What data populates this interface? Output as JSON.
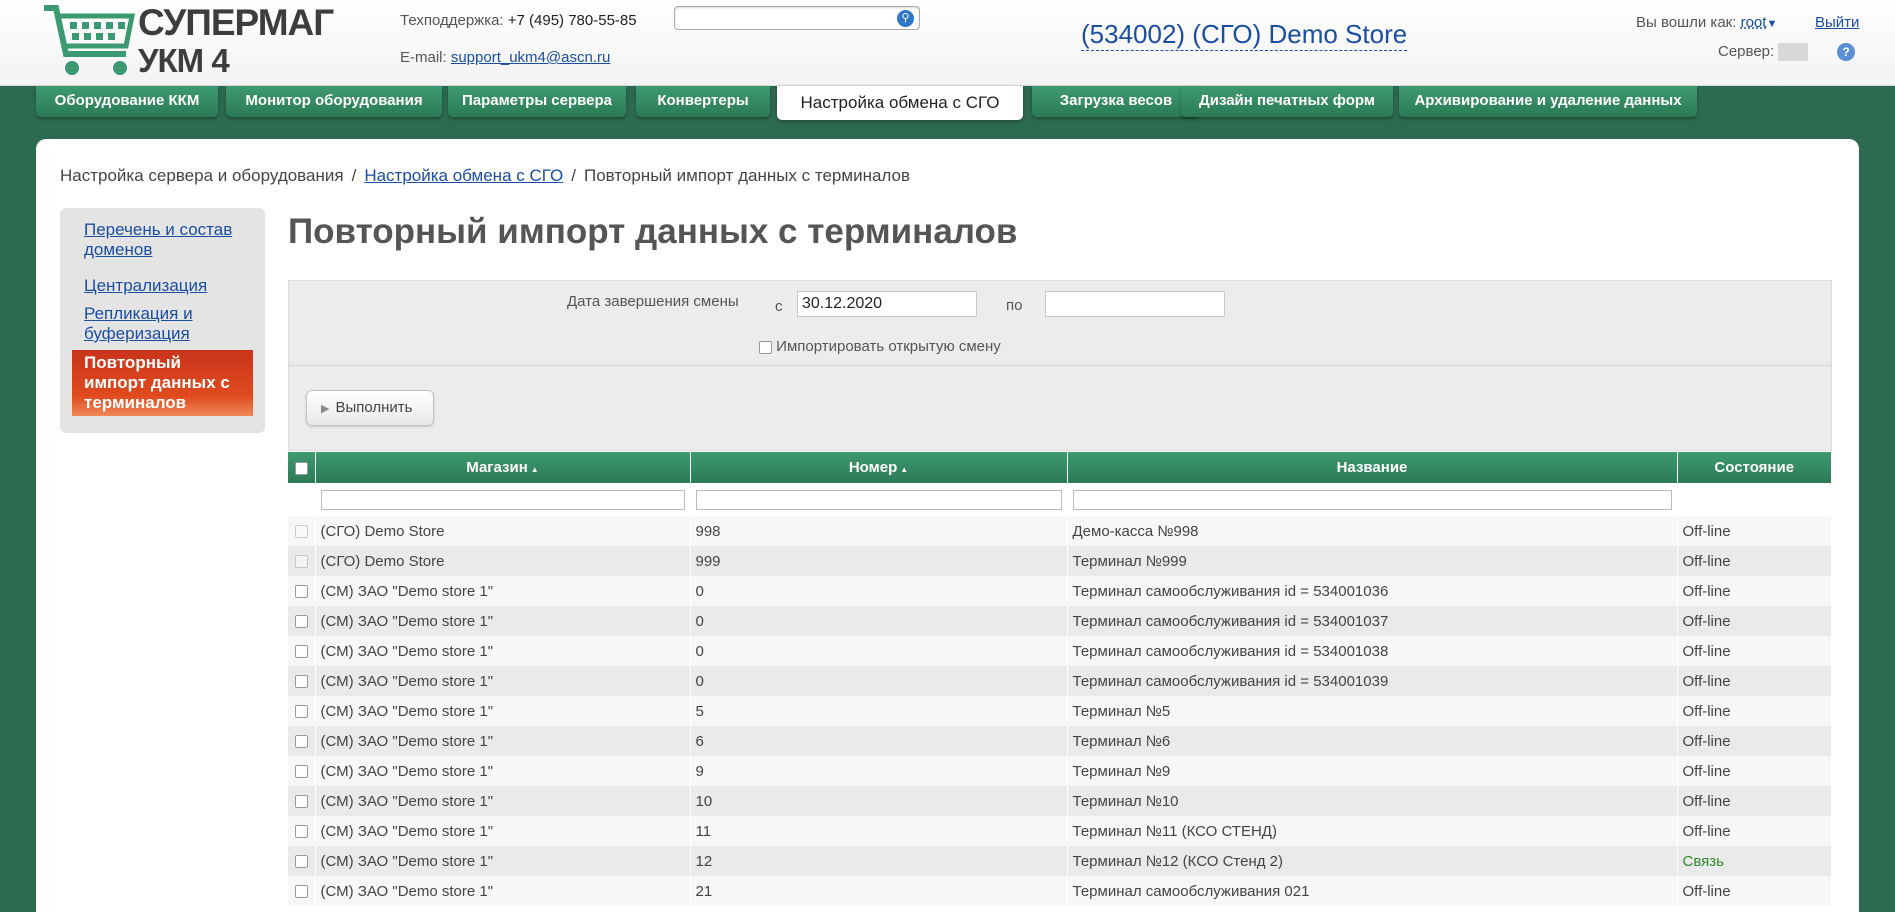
{
  "header": {
    "logo_line1": "СУПЕРМАГ",
    "logo_line2": "УКМ 4",
    "support_label": "Техподдержка:",
    "support_phone": "+7 (495) 780-55-85",
    "email_label": "E-mail:",
    "email": "support_ukm4@ascn.ru",
    "search_value": "",
    "store_title": "(534002) (СГО) Demo Store",
    "login_label": "Вы вошли как:",
    "login_user": "root",
    "logout": "Выйти",
    "server_label": "Сервер:",
    "help": "?"
  },
  "tabs": [
    {
      "label": "Оборудование ККМ"
    },
    {
      "label": "Монитор оборудования"
    },
    {
      "label": "Параметры сервера"
    },
    {
      "label": "Конвертеры"
    },
    {
      "label": "Настройка обмена с СГО"
    },
    {
      "label": "Загрузка весов"
    },
    {
      "label": "Дизайн печатных форм"
    },
    {
      "label": "Архивирование и удаление данных"
    }
  ],
  "breadcrumb": {
    "root": "Настройка сервера и оборудования",
    "section": "Настройка обмена с СГО",
    "current": "Повторный импорт данных с терминалов",
    "sep": "/"
  },
  "sidebar": {
    "items": [
      {
        "label": "Перечень и состав доменов"
      },
      {
        "label": "Централизация"
      },
      {
        "label": "Репликация и буферизация"
      },
      {
        "label": "Повторный импорт данных с терминалов"
      }
    ]
  },
  "page_title": "Повторный импорт данных с терминалов",
  "filter": {
    "label": "Дата завершения смены",
    "from_label": "с",
    "from_value": "30.12.2020",
    "to_label": "по",
    "to_value": "",
    "open_shift_label": "Импортировать открытую смену",
    "run_label": "Выполнить"
  },
  "table": {
    "headers": [
      "Магазин",
      "Номер",
      "Название",
      "Состояние"
    ],
    "rows": [
      {
        "shop": "(СГО) Demo Store",
        "num": "998",
        "name": "Демо-касса №998",
        "status": "Off-line"
      },
      {
        "shop": "(СГО) Demo Store",
        "num": "999",
        "name": "Терминал №999",
        "status": "Off-line"
      },
      {
        "shop": "(СМ) ЗАО \"Demo store 1\"",
        "num": "0",
        "name": "Терминал самообслуживания id = 534001036",
        "status": "Off-line"
      },
      {
        "shop": "(СМ) ЗАО \"Demo store 1\"",
        "num": "0",
        "name": "Терминал самообслуживания id = 534001037",
        "status": "Off-line"
      },
      {
        "shop": "(СМ) ЗАО \"Demo store 1\"",
        "num": "0",
        "name": "Терминал самообслуживания id = 534001038",
        "status": "Off-line"
      },
      {
        "shop": "(СМ) ЗАО \"Demo store 1\"",
        "num": "0",
        "name": "Терминал самообслуживания id = 534001039",
        "status": "Off-line"
      },
      {
        "shop": "(СМ) ЗАО \"Demo store 1\"",
        "num": "5",
        "name": "Терминал №5",
        "status": "Off-line"
      },
      {
        "shop": "(СМ) ЗАО \"Demo store 1\"",
        "num": "6",
        "name": "Терминал №6",
        "status": "Off-line"
      },
      {
        "shop": "(СМ) ЗАО \"Demo store 1\"",
        "num": "9",
        "name": "Терминал №9",
        "status": "Off-line"
      },
      {
        "shop": "(СМ) ЗАО \"Demo store 1\"",
        "num": "10",
        "name": "Терминал №10",
        "status": "Off-line"
      },
      {
        "shop": "(СМ) ЗАО \"Demo store 1\"",
        "num": "11",
        "name": "Терминал №11 (КСО СТЕНД)",
        "status": "Off-line"
      },
      {
        "shop": "(СМ) ЗАО \"Demo store 1\"",
        "num": "12",
        "name": "Терминал №12 (КСО Стенд 2)",
        "status": "Связь"
      },
      {
        "shop": "(СМ) ЗАО \"Demo store 1\"",
        "num": "21",
        "name": "Терминал самообслуживания 021",
        "status": "Off-line"
      }
    ]
  },
  "colors": {
    "accent": "#2a7a55",
    "active_item": "#e04a1e",
    "link": "#1a4ea0",
    "online": "#2a8a2a"
  }
}
